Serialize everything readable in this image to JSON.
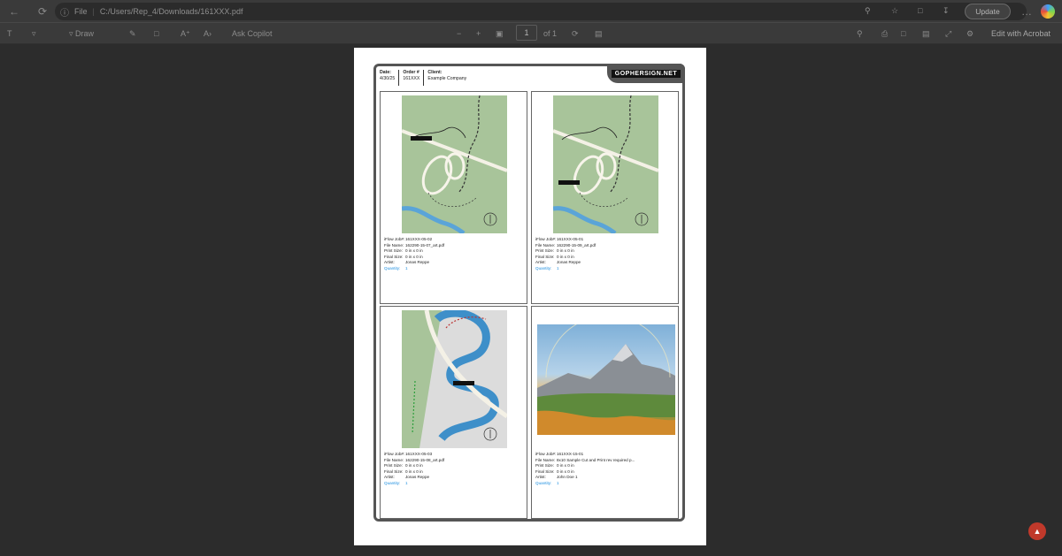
{
  "browser": {
    "file_label": "File",
    "url": "C:/Users/Rep_4/Downloads/161XXX.pdf",
    "update_label": "Update"
  },
  "pdf_toolbar": {
    "draw_label": "Draw",
    "ai_label": "Ask Copilot",
    "page_current": "1",
    "page_total": "of 1",
    "edit_acrobat": "Edit with Acrobat"
  },
  "order_header": {
    "date_label": "Date:",
    "date_value": "4/30/25",
    "order_label": "Order #",
    "order_value": "161XXX",
    "client_label": "Client:",
    "client_value": "Example Company",
    "logo_text": "GOPHERSIGN.NET"
  },
  "meta_labels": {
    "job": "iFlow Job#:",
    "file": "File Name:",
    "print": "Print Size:",
    "final": "Final Size:",
    "artist": "Artist:",
    "qty": "Quantity:"
  },
  "items": [
    {
      "job": "161XXX-05-02",
      "file": "162290-15-07_art.pdf",
      "print": "0 in x 0 in",
      "final": "0 in x 0 in",
      "artist": "Jonas Reppe",
      "qty": "1",
      "thumb": "map-a"
    },
    {
      "job": "161XXX-05-01",
      "file": "162290-15-09_art.pdf",
      "print": "0 in x 0 in",
      "final": "0 in x 0 in",
      "artist": "Jonas Reppe",
      "qty": "1",
      "thumb": "map-b"
    },
    {
      "job": "161XXX-05-03",
      "file": "162290-15-08_art.pdf",
      "print": "0 in x 0 in",
      "final": "0 in x 0 in",
      "artist": "Jonas Reppe",
      "qty": "1",
      "thumb": "map-c"
    },
    {
      "job": "161XXX-15-01",
      "file": "8x10 Sample Cut and Print rev required p...",
      "print": "0 in x 0 in",
      "final": "0 in x 0 in",
      "artist": "John Doe 1",
      "qty": "1",
      "thumb": "photo"
    }
  ],
  "map_labels": {
    "you_are_here": "You Are Here",
    "north": "North"
  }
}
